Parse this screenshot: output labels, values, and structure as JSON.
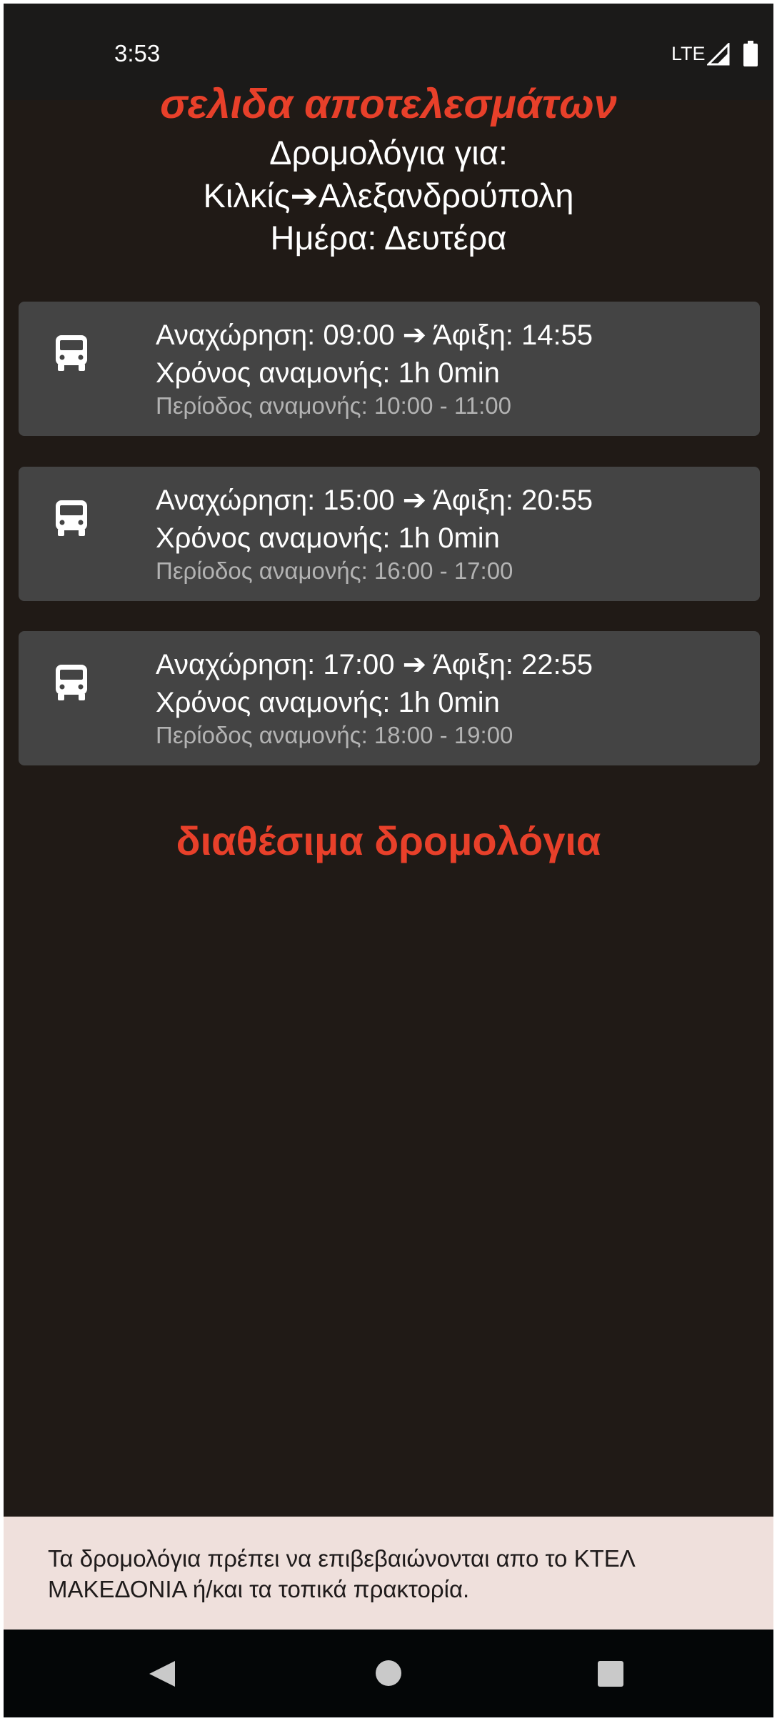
{
  "status_bar": {
    "time": "3:53",
    "network": "LTE",
    "icons": [
      "signal-icon",
      "battery-icon"
    ]
  },
  "header": {
    "title": "σελιδα αποτελεσμάτων",
    "line1": "Δρομολόγια για:",
    "route": "Κιλκίς➔Αλεξανδρούπολη",
    "day": "Ημέρα: Δευτέρα"
  },
  "trips": [
    {
      "departure_label": "Αναχώρηση: 09:00",
      "arrow": "➔",
      "arrival_label": "Άφιξη: 14:55",
      "wait_time": "Χρόνος αναμονής: 1h 0min",
      "wait_period": "Περίοδος αναμονής: 10:00 - 11:00",
      "icon": "bus-icon"
    },
    {
      "departure_label": "Αναχώρηση: 15:00",
      "arrow": "➔",
      "arrival_label": "Άφιξη: 20:55",
      "wait_time": "Χρόνος αναμονής: 1h 0min",
      "wait_period": "Περίοδος αναμονής: 16:00 - 17:00",
      "icon": "bus-icon"
    },
    {
      "departure_label": "Αναχώρηση: 17:00",
      "arrow": "➔",
      "arrival_label": "Άφιξη: 22:55",
      "wait_time": "Χρόνος αναμονής: 1h 0min",
      "wait_period": "Περίοδος αναμονής: 18:00 - 19:00",
      "icon": "bus-icon"
    }
  ],
  "section_title": "διαθέσιμα δρομολόγια",
  "notice": {
    "text": "Τα δρομολόγια πρέπει να επιβεβαιώνονται απο το ΚΤΕΛ ΜΑΚΕΔΟΝΙΑ ή/και τα τοπικά πρακτορία."
  },
  "nav_bar": {
    "icons": [
      "back-icon",
      "home-icon",
      "recents-icon"
    ]
  },
  "colors": {
    "background": "#201a16",
    "accent_red": "#e8402a",
    "card": "#444444",
    "notice_bg": "#efe0dc"
  }
}
